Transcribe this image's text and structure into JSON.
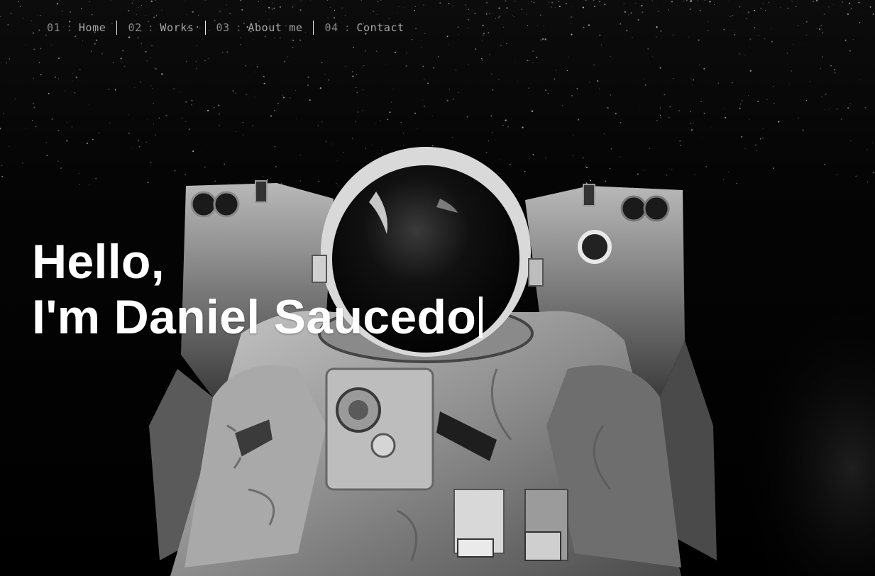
{
  "nav": {
    "items": [
      {
        "num": "01",
        "sep": ":",
        "label": "Home"
      },
      {
        "num": "02",
        "sep": ":",
        "label": "Works"
      },
      {
        "num": "03",
        "sep": ":",
        "label": "About me"
      },
      {
        "num": "04",
        "sep": ":",
        "label": "Contact"
      }
    ]
  },
  "hero": {
    "greeting": "Hello,",
    "intro": "I'm Daniel Saucedo",
    "background": "astronaut-photo",
    "text_color": "#ffffff",
    "background_color": "#000000"
  }
}
